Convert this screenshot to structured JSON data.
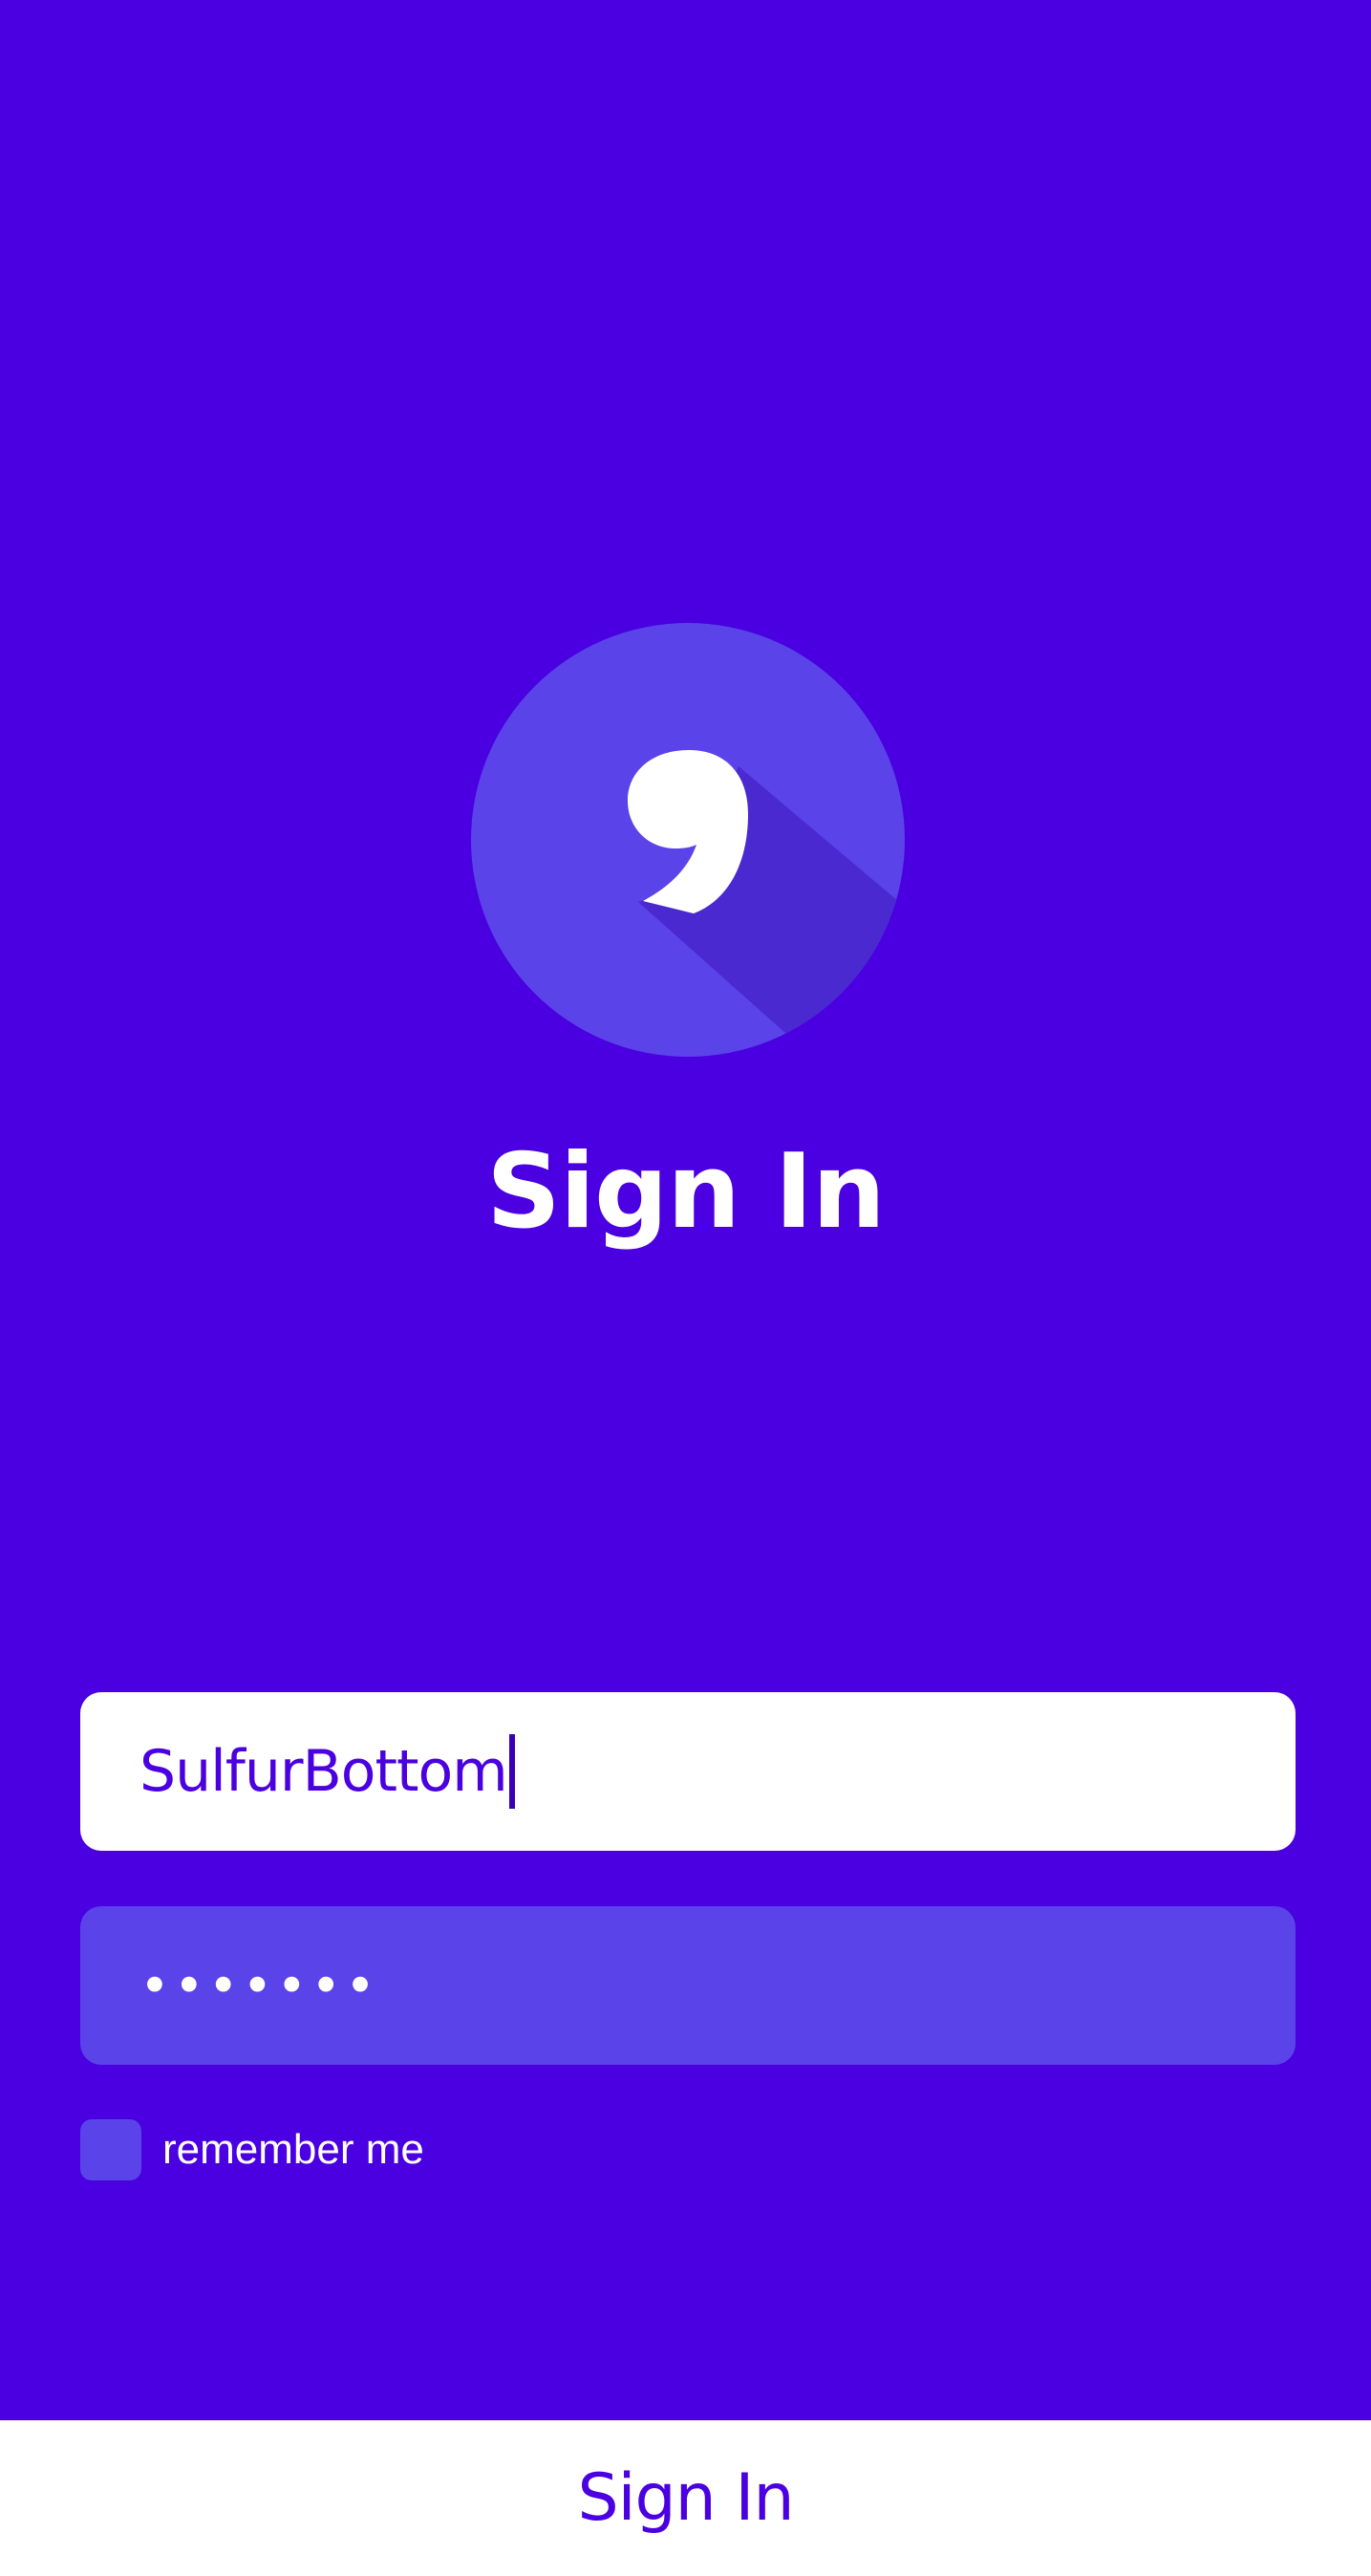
{
  "header": {
    "title": "Sign In",
    "logo_icon": "comma-logo-icon"
  },
  "form": {
    "username_value": "SulfurBottom",
    "password_value": "•••••••",
    "remember_label": "remember me",
    "remember_checked": false
  },
  "footer": {
    "signin_label": "Sign In"
  },
  "colors": {
    "background": "#4a00e0",
    "accent_light": "#5a43e8",
    "shadow": "#4a2ad0",
    "white": "#ffffff"
  }
}
